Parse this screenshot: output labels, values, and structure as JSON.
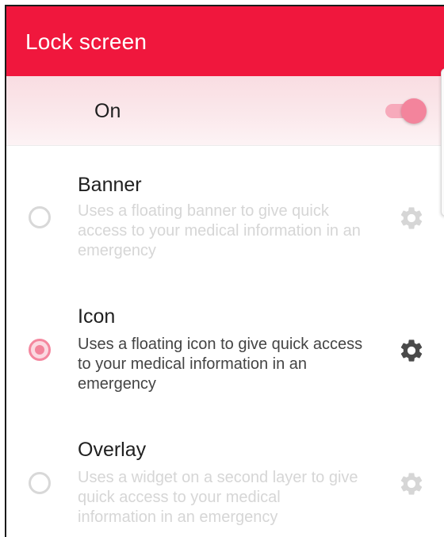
{
  "appbar": {
    "title": "Lock screen"
  },
  "master_toggle": {
    "label": "On",
    "state": "on",
    "accent": "#f3849c"
  },
  "options": [
    {
      "title": "Banner",
      "description": "Uses a floating banner to give quick access to your medical information in an emergency",
      "selected": false,
      "enabled": false
    },
    {
      "title": "Icon",
      "description": "Uses a floating icon to give quick access to your medical information in an emergency",
      "selected": true,
      "enabled": true
    },
    {
      "title": "Overlay",
      "description": "Uses a widget on a second layer to give quick access to your medical information in an emergency",
      "selected": false,
      "enabled": false
    }
  ],
  "colors": {
    "brand": "#f0173d",
    "disabled_text": "#d6d6d6",
    "enabled_icon": "#4a4a4a"
  }
}
